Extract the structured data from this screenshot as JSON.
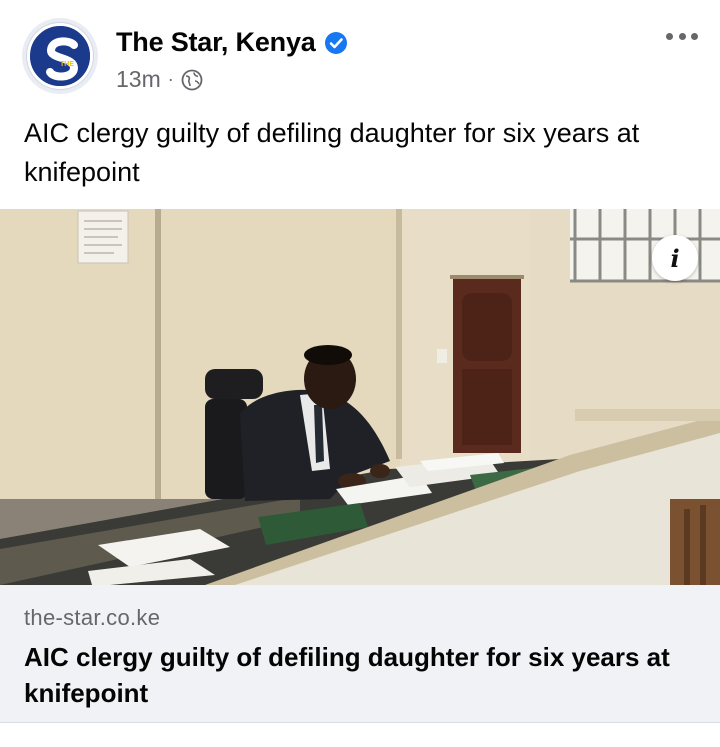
{
  "post": {
    "page_name": "The Star, Kenya",
    "verified": true,
    "time_ago": "13m",
    "separator": "·",
    "audience_icon": "globe-icon",
    "more_icon": "more-options-icon",
    "caption": "AIC clergy guilty of defiling daughter for six years at knifepoint",
    "avatar_logo_letter": "S",
    "avatar_logo_small": "THE"
  },
  "image": {
    "info_glyph": "i",
    "description_icon": "info-icon"
  },
  "link_preview": {
    "domain": "the-star.co.ke",
    "title": "AIC clergy guilty of defiling daughter for six years at knifepoint"
  },
  "colors": {
    "brand_blue": "#1c3a8c",
    "verified_blue": "#1877f2",
    "secondary_text": "#65676b",
    "card_bg": "#f0f2f5"
  }
}
